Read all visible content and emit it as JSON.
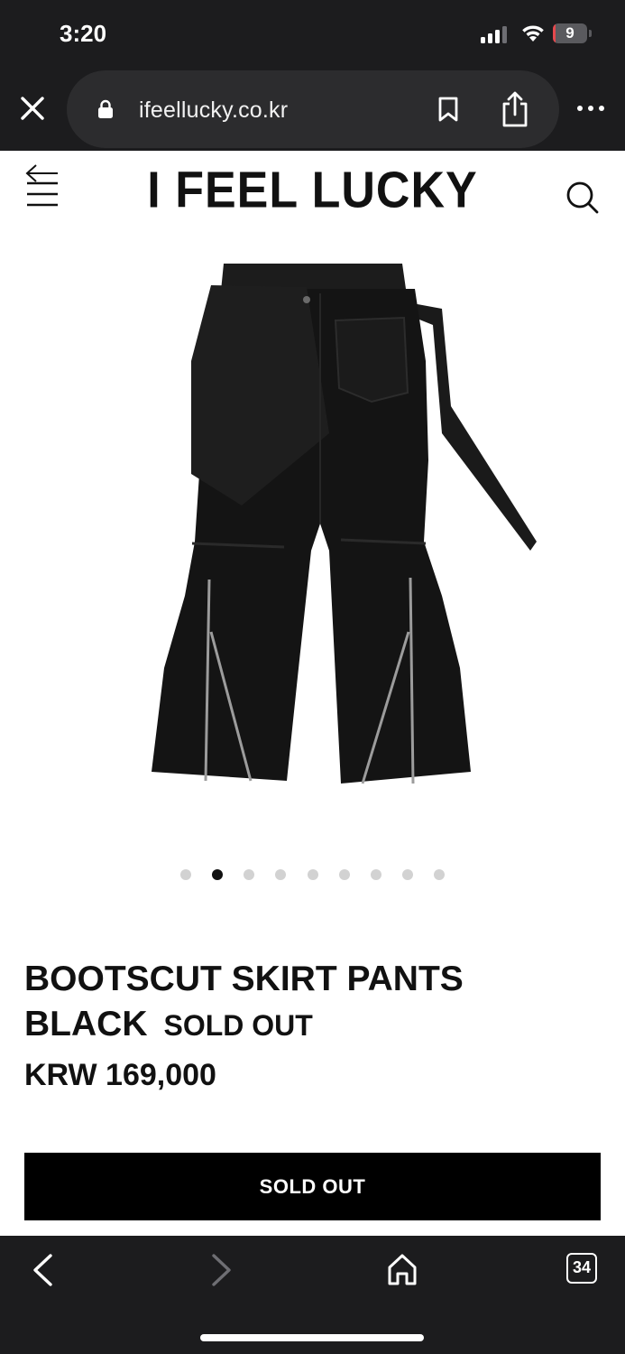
{
  "status_bar": {
    "time": "3:20",
    "battery_level": "9",
    "battery_percent": 9,
    "icons": [
      "signal-icon",
      "wifi-icon",
      "battery-icon"
    ]
  },
  "browser": {
    "url": "ifeellucky.co.kr",
    "icons": [
      "close-icon",
      "lock-icon",
      "bookmark-icon",
      "share-icon",
      "more-icon"
    ]
  },
  "site": {
    "logo": "I FEEL LUCKY",
    "icons": [
      "menu-icon",
      "search-icon"
    ]
  },
  "product": {
    "image": "black-flared-pants-with-zippers-and-strap",
    "carousel": {
      "count": 9,
      "active_index": 1
    },
    "title": "BOOTSCUT SKIRT PANTS BLACK",
    "status": "SOLD OUT",
    "price": "KRW 169,000",
    "button_label": "SOLD OUT"
  },
  "toolbar": {
    "tab_count": "34",
    "icons": [
      "back-icon",
      "forward-icon",
      "home-icon",
      "tabs-icon"
    ]
  },
  "colors": {
    "chrome_bg": "#1c1c1e",
    "pill_bg": "#2c2c2e",
    "battery_red": "#e5484d",
    "button_bg": "#000000"
  }
}
